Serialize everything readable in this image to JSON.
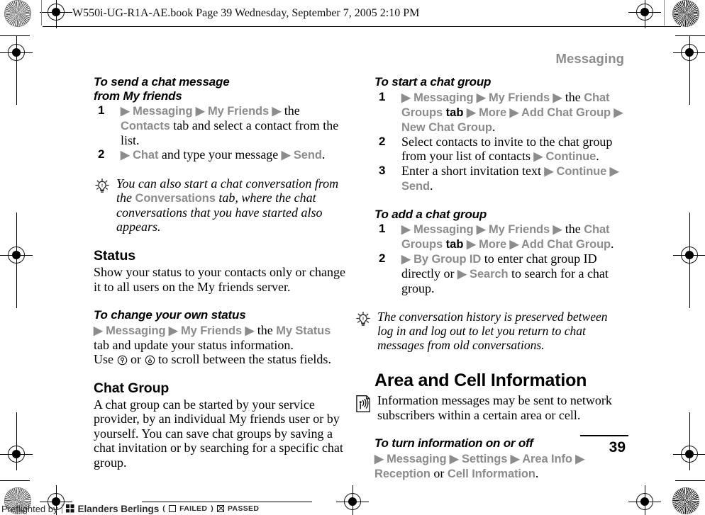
{
  "print_marks": {
    "header_line": "W550i-UG-R1A-AE.book  Page 39  Wednesday, September 7, 2005  2:10 PM"
  },
  "page": {
    "running_head": "Messaging",
    "folio": "39"
  },
  "left_column": {
    "proc1": {
      "heading_line1": "To send a chat message",
      "heading_line2": "from My friends",
      "steps": [
        {
          "num": "1",
          "parts": [
            {
              "t": "▶ Messaging ▶ My Friends ▶",
              "s": "ui"
            },
            {
              "t": " the ",
              "s": "blk"
            },
            {
              "t": "Contacts",
              "s": "ui"
            },
            {
              "t": " tab and select a contact from the list.",
              "s": "blk"
            }
          ]
        },
        {
          "num": "2",
          "parts": [
            {
              "t": "▶ Chat",
              "s": "ui"
            },
            {
              "t": " and type your message ",
              "s": "blk"
            },
            {
              "t": "▶ Send",
              "s": "ui"
            },
            {
              "t": ".",
              "s": "blk"
            }
          ]
        }
      ]
    },
    "tip1": {
      "icon": "lightbulb-icon",
      "parts": [
        {
          "t": "You can also start a chat conversation from the ",
          "s": "blk"
        },
        {
          "t": "Conversations",
          "s": "ui"
        },
        {
          "t": " tab, where the chat conversations that you have started also appears.",
          "s": "blk"
        }
      ]
    },
    "status_section": {
      "heading": "Status",
      "body": "Show your status to your contacts only or change it to all users on the My friends server."
    },
    "proc2": {
      "heading": "To change your own status",
      "parts": [
        {
          "t": "▶ Messaging ▶ My Friends ▶",
          "s": "ui"
        },
        {
          "t": " the ",
          "s": "blk"
        },
        {
          "t": "My Status",
          "s": "ui"
        },
        {
          "t": " tab and update your status information.",
          "s": "blk"
        }
      ],
      "scroll_line_pre": "Use ",
      "scroll_icon_a": "nav-key-down-icon",
      "scroll_line_mid": " or ",
      "scroll_icon_b": "nav-key-up-icon",
      "scroll_line_post": " to scroll between the status fields."
    },
    "chat_group_section": {
      "heading": "Chat Group",
      "body": "A chat group can be started by your service provider, by an individual My friends user or by yourself. You can save chat groups by saving a chat invitation or by searching for a specific chat group."
    }
  },
  "right_column": {
    "proc3": {
      "heading": "To start a chat group",
      "steps": [
        {
          "num": "1",
          "parts": [
            {
              "t": "▶ Messaging ▶ My Friends ▶",
              "s": "ui"
            },
            {
              "t": " the ",
              "s": "blk"
            },
            {
              "t": "Chat Groups",
              "s": "ui"
            },
            {
              "t": " tab ",
              "s": "blk-sans"
            },
            {
              "t": "▶ More ▶ Add Chat Group ▶ New Chat Group",
              "s": "ui"
            },
            {
              "t": ".",
              "s": "blk"
            }
          ]
        },
        {
          "num": "2",
          "parts": [
            {
              "t": "Select contacts to invite to the chat group from your list of contacts ",
              "s": "blk"
            },
            {
              "t": "▶ Continue",
              "s": "ui"
            },
            {
              "t": ".",
              "s": "blk"
            }
          ]
        },
        {
          "num": "3",
          "parts": [
            {
              "t": "Enter a short invitation text ",
              "s": "blk"
            },
            {
              "t": "▶ Continue ▶ Send",
              "s": "ui"
            },
            {
              "t": ".",
              "s": "blk"
            }
          ]
        }
      ]
    },
    "proc4": {
      "heading": "To add a chat group",
      "steps": [
        {
          "num": "1",
          "parts": [
            {
              "t": "▶ Messaging ▶ My Friends ▶",
              "s": "ui"
            },
            {
              "t": " the ",
              "s": "blk"
            },
            {
              "t": "Chat Groups",
              "s": "ui"
            },
            {
              "t": " tab ",
              "s": "blk-sans"
            },
            {
              "t": "▶ More ▶ Add Chat Group",
              "s": "ui"
            },
            {
              "t": ".",
              "s": "blk"
            }
          ]
        },
        {
          "num": "2",
          "parts": [
            {
              "t": "▶ By Group ID",
              "s": "ui"
            },
            {
              "t": " to enter chat group ID directly or ",
              "s": "blk"
            },
            {
              "t": "▶ Search",
              "s": "ui"
            },
            {
              "t": " to search for a chat group.",
              "s": "blk"
            }
          ]
        }
      ]
    },
    "tip2": {
      "icon": "lightbulb-icon",
      "text": "The conversation history is preserved between log in and log out to let you return to chat messages from old conversations."
    },
    "area_section": {
      "heading": "Area and Cell Information",
      "icon": "broadcast-page-icon",
      "body": "Information messages may be sent to network subscribers within a certain area or cell."
    },
    "proc5": {
      "heading": "To turn information on or off",
      "parts": [
        {
          "t": "▶ Messaging ▶ Settings ▶ Area Info ▶ Reception",
          "s": "ui"
        },
        {
          "t": " or ",
          "s": "blk"
        },
        {
          "t": "Cell Information",
          "s": "ui"
        },
        {
          "t": ".",
          "s": "blk"
        }
      ]
    }
  },
  "footer": {
    "preflight_label": "Preflighted by",
    "brand": "Elanders Berlings",
    "open_paren": "(",
    "failed_label": "FAILED",
    "close_paren": ")",
    "passed_label": "PASSED"
  },
  "colors": {
    "ui_gray": "#8c8c8c",
    "running_head_gray": "#8c8c8c",
    "text_black": "#000000",
    "page_white": "#ffffff"
  }
}
